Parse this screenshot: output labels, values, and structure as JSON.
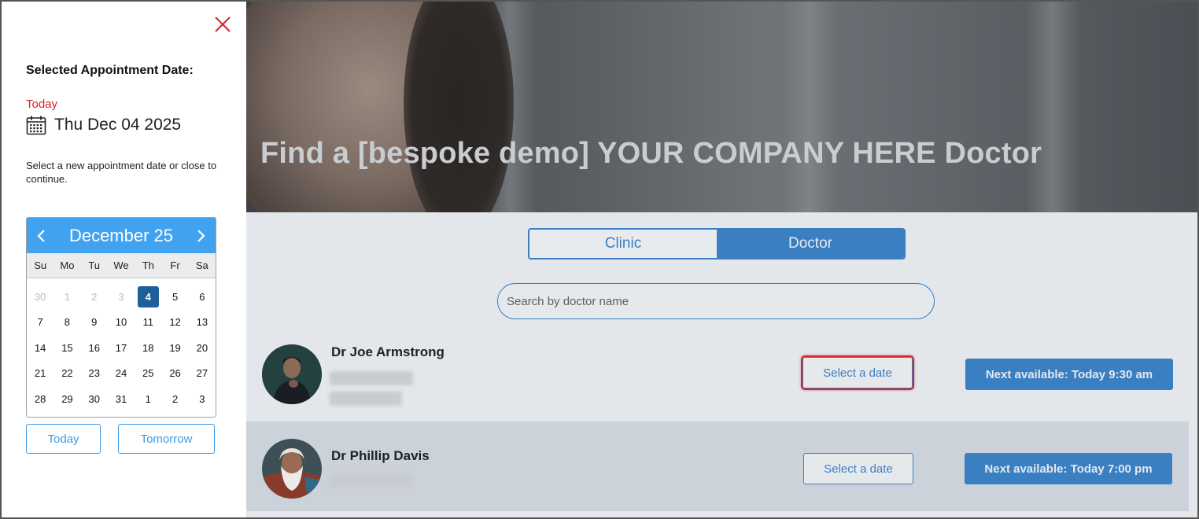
{
  "panel": {
    "close_icon": "close-icon",
    "title": "Selected Appointment Date:",
    "today_label": "Today",
    "selected_date": "Thu Dec 04 2025",
    "hint": "Select a new appointment date or close to continue.",
    "calendar": {
      "month_label": "December 25",
      "weekdays": [
        "Su",
        "Mo",
        "Tu",
        "We",
        "Th",
        "Fr",
        "Sa"
      ],
      "days": [
        {
          "d": "30",
          "muted": true
        },
        {
          "d": "1",
          "muted": true
        },
        {
          "d": "2",
          "muted": true
        },
        {
          "d": "3",
          "muted": true
        },
        {
          "d": "4",
          "selected": true
        },
        {
          "d": "5"
        },
        {
          "d": "6"
        },
        {
          "d": "7"
        },
        {
          "d": "8"
        },
        {
          "d": "9"
        },
        {
          "d": "10"
        },
        {
          "d": "11"
        },
        {
          "d": "12"
        },
        {
          "d": "13"
        },
        {
          "d": "14"
        },
        {
          "d": "15"
        },
        {
          "d": "16"
        },
        {
          "d": "17"
        },
        {
          "d": "18"
        },
        {
          "d": "19"
        },
        {
          "d": "20"
        },
        {
          "d": "21"
        },
        {
          "d": "22"
        },
        {
          "d": "23"
        },
        {
          "d": "24"
        },
        {
          "d": "25"
        },
        {
          "d": "26"
        },
        {
          "d": "27"
        },
        {
          "d": "28"
        },
        {
          "d": "29"
        },
        {
          "d": "30"
        },
        {
          "d": "31"
        },
        {
          "d": "1"
        },
        {
          "d": "2"
        },
        {
          "d": "3"
        }
      ],
      "header_color": "#41a2f0",
      "selected_color": "#1e5f99"
    },
    "today_button": "Today",
    "tomorrow_button": "Tomorrow"
  },
  "page": {
    "hero_title": "Find a [bespoke demo] YOUR COMPANY HERE Doctor",
    "tabs": [
      {
        "label": "Clinic",
        "active": false
      },
      {
        "label": "Doctor",
        "active": true
      }
    ],
    "search_placeholder": "Search by doctor name",
    "doctors": [
      {
        "name": "Dr Joe Armstrong",
        "select_label": "Select a date",
        "next_label": "Next available: Today 9:30 am"
      },
      {
        "name": "Dr Phillip Davis",
        "select_label": "Select a date",
        "next_label": "Next available: Today 7:00 pm"
      }
    ],
    "accent_color": "#3a7fc2",
    "highlight_color": "#d8232a"
  }
}
